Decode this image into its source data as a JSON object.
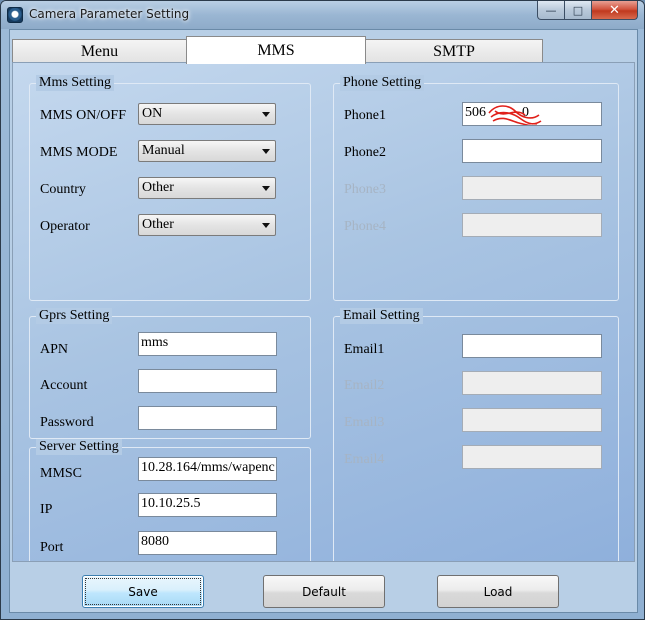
{
  "window": {
    "title": "Camera Parameter Setting",
    "icon": "camera-app-icon",
    "controls": {
      "minimize": "—",
      "maximize": "□",
      "close": "✕"
    }
  },
  "tabs": [
    {
      "label": "Menu",
      "active": false
    },
    {
      "label": "MMS",
      "active": true
    },
    {
      "label": "SMTP",
      "active": false
    }
  ],
  "mms_setting": {
    "title": "Mms Setting",
    "rows": [
      {
        "label": "MMS ON/OFF",
        "value": "ON"
      },
      {
        "label": "MMS MODE",
        "value": "Manual"
      },
      {
        "label": "Country",
        "value": "Other"
      },
      {
        "label": "Operator",
        "value": "Other"
      }
    ]
  },
  "gprs_setting": {
    "title": "Gprs Setting",
    "rows": [
      {
        "label": "APN",
        "value": "mms"
      },
      {
        "label": "Account",
        "value": ""
      },
      {
        "label": "Password",
        "value": ""
      }
    ]
  },
  "server_setting": {
    "title": "Server Setting",
    "rows": [
      {
        "label": "MMSC",
        "value": "10.28.164/mms/wapenc"
      },
      {
        "label": "IP",
        "value": "10.10.25.5"
      },
      {
        "label": "Port",
        "value": "8080"
      }
    ]
  },
  "phone_setting": {
    "title": "Phone Setting",
    "rows": [
      {
        "label": "Phone1",
        "value": "506",
        "value_tail": "0",
        "enabled": true,
        "redacted": true
      },
      {
        "label": "Phone2",
        "value": "",
        "enabled": true
      },
      {
        "label": "Phone3",
        "value": "",
        "enabled": false
      },
      {
        "label": "Phone4",
        "value": "",
        "enabled": false
      }
    ]
  },
  "email_setting": {
    "title": "Email Setting",
    "rows": [
      {
        "label": "Email1",
        "value": "",
        "enabled": true
      },
      {
        "label": "Email2",
        "value": "",
        "enabled": false
      },
      {
        "label": "Email3",
        "value": "",
        "enabled": false
      },
      {
        "label": "Email4",
        "value": "",
        "enabled": false
      }
    ]
  },
  "buttons": {
    "save": "Save",
    "default": "Default",
    "load": "Load"
  },
  "colors": {
    "scribble": "#e0201a",
    "close_button": "#c0391f"
  }
}
